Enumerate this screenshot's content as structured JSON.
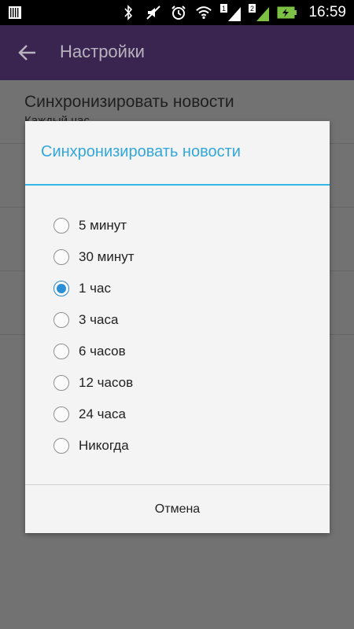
{
  "status_bar": {
    "time": "16:59",
    "sim1": "1",
    "sim2": "2",
    "icons": [
      "keyboard-icon",
      "bluetooth-icon",
      "mute-icon",
      "alarm-icon",
      "wifi-icon",
      "signal-sim1-icon",
      "signal-sim2-icon",
      "battery-charging-icon"
    ]
  },
  "app_bar": {
    "title": "Настройки"
  },
  "preference": {
    "title": "Синхронизировать новости",
    "summary": "Каждый час"
  },
  "dialog": {
    "title": "Синхронизировать новости",
    "options": [
      {
        "label": "5 минут",
        "checked": false
      },
      {
        "label": "30 минут",
        "checked": false
      },
      {
        "label": "1 час",
        "checked": true
      },
      {
        "label": "3 часа",
        "checked": false
      },
      {
        "label": "6 часов",
        "checked": false
      },
      {
        "label": "12 часов",
        "checked": false
      },
      {
        "label": "24 часа",
        "checked": false
      },
      {
        "label": "Никогда",
        "checked": false
      }
    ],
    "cancel_label": "Отмена"
  },
  "colors": {
    "accent": "#33b5e5",
    "app_bar": "#5b3a82",
    "radio_checked": "#2b8fd6"
  }
}
